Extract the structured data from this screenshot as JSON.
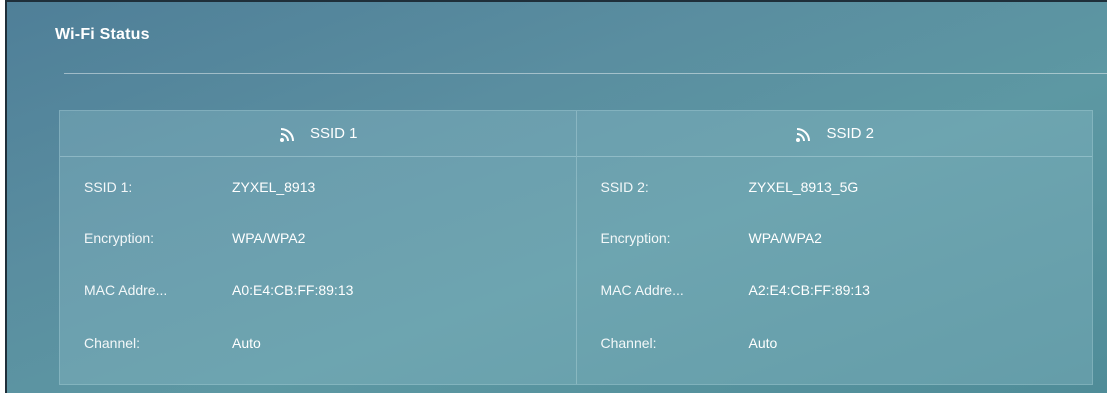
{
  "panel": {
    "title": "Wi-Fi Status"
  },
  "ssids": [
    {
      "header": "SSID 1",
      "icon": "wifi-icon",
      "rows": [
        {
          "label": "SSID 1:",
          "value": "ZYXEL_8913"
        },
        {
          "label": "Encryption:",
          "value": "WPA/WPA2"
        },
        {
          "label": "MAC Addre...",
          "value": "A0:E4:CB:FF:89:13"
        },
        {
          "label": "Channel:",
          "value": "Auto"
        }
      ]
    },
    {
      "header": "SSID 2",
      "icon": "wifi-icon",
      "rows": [
        {
          "label": "SSID 2:",
          "value": "ZYXEL_8913_5G"
        },
        {
          "label": "Encryption:",
          "value": "WPA/WPA2"
        },
        {
          "label": "MAC Addre...",
          "value": "A2:E4:CB:FF:89:13"
        },
        {
          "label": "Channel:",
          "value": "Auto"
        }
      ]
    }
  ]
}
